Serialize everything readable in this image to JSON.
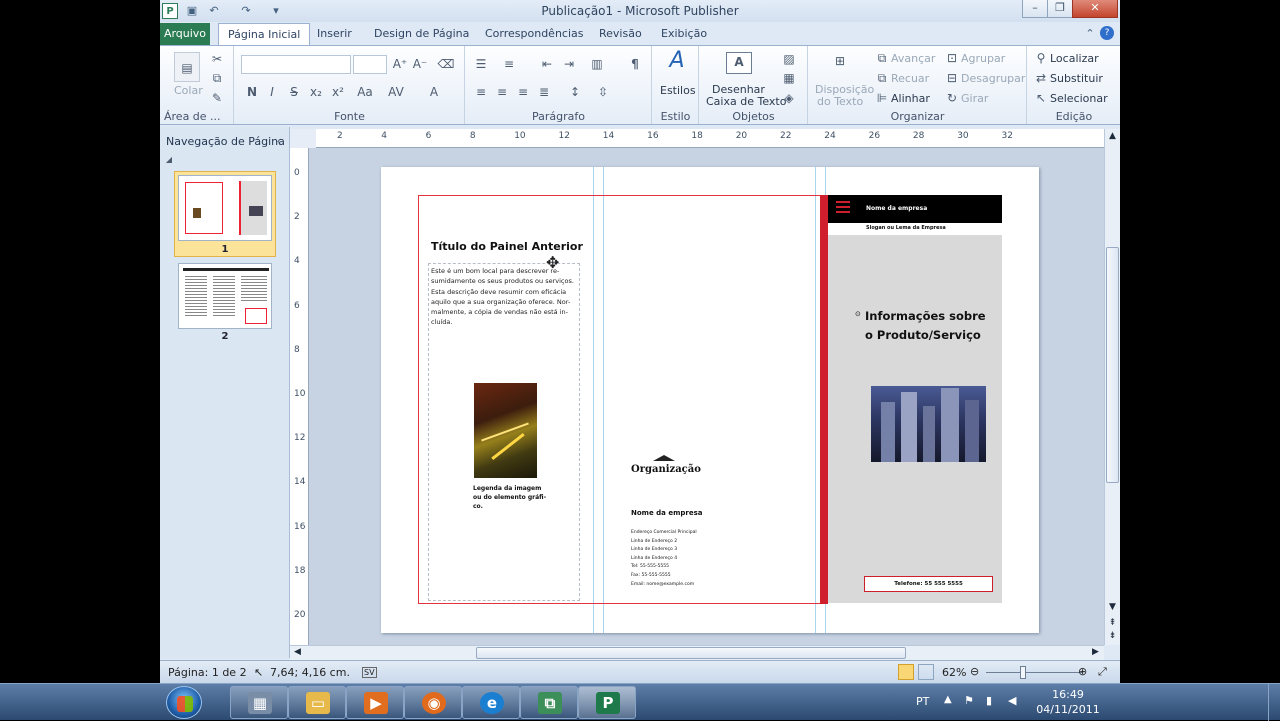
{
  "window": {
    "title": "Publicação1  -  Microsoft Publisher",
    "app_icon": "P",
    "quick_access": [
      "save-icon",
      "undo-icon",
      "redo-icon",
      "customize-icon"
    ]
  },
  "tabs": [
    "Arquivo",
    "Página Inicial",
    "Inserir",
    "Design de Página",
    "Correspondências",
    "Revisão",
    "Exibição"
  ],
  "ribbon": {
    "clipboard": {
      "paste": "Colar",
      "group": "Área de ..."
    },
    "font": {
      "group": "Fonte",
      "font_name": "",
      "font_size": "",
      "bold": "N",
      "italic": "I",
      "underline": "S",
      "sub": "x₂",
      "sup": "x²",
      "case": "Aa"
    },
    "paragraph": {
      "group": "Parágrafo",
      "pilcrow": "¶"
    },
    "styles": {
      "label": "Estilos",
      "group": "Estilo"
    },
    "objects": {
      "draw_textbox_1": "Desenhar",
      "draw_textbox_2": "Caixa de Texto",
      "wrap_1": "Disposição",
      "wrap_2": "do Texto",
      "group": "Objetos"
    },
    "arrange": {
      "forward": "Avançar",
      "backward": "Recuar",
      "align": "Alinhar",
      "group_btn": "Agrupar",
      "ungroup": "Desagrupar",
      "rotate": "Girar",
      "group": "Organizar"
    },
    "editing": {
      "find": "Localizar",
      "replace": "Substituir",
      "select": "Selecionar",
      "group": "Edição"
    }
  },
  "nav": {
    "title": "Navegação de Página",
    "pages": [
      "1",
      "2"
    ]
  },
  "rulers": {
    "h_ticks": [
      "2",
      "4",
      "6",
      "8",
      "10",
      "12",
      "14",
      "16",
      "18",
      "20",
      "22",
      "24",
      "26",
      "28",
      "30",
      "32"
    ],
    "v_ticks": [
      "0",
      "2",
      "4",
      "6",
      "8",
      "10",
      "12",
      "14",
      "16",
      "18",
      "20"
    ]
  },
  "document": {
    "left_title": "Título do Painel Anterior",
    "left_body": [
      "Este é um bom local para descrever re-",
      "sumidamente os seus produtos ou serviços.",
      "Esta descrição deve resumir com eficácia",
      "aquilo que a sua organização oferece. Nor-",
      "malmente, a cópia de vendas não está in-",
      "cluída."
    ],
    "caption": [
      "Legenda da imagem",
      "ou do elemento gráfi-",
      "co."
    ],
    "org_title": "Organização",
    "company": "Nome da empresa",
    "address": [
      "Endereço Comercial Principal",
      "Linha de Endereço 2",
      "Linha de Endereço 3",
      "Linha de Endereço 4",
      "Tel: 55-555-5555",
      "Fax: 55-555-5555",
      "Email: nome@example.com"
    ],
    "cover_company": "Nome da empresa",
    "cover_slogan": "Slogan ou Lema da Empresa",
    "cover_title_1": "Informações sobre",
    "cover_title_2": "o Produto/Serviço",
    "phone": "Telefone: 55 555 5555"
  },
  "status": {
    "page": "Página: 1 de 2",
    "position": "7,64; 4,16 cm.",
    "zoom": "62%"
  },
  "zoom_level_percent": 62,
  "taskbar": {
    "lang": "PT",
    "time": "16:49",
    "date": "04/11/2011",
    "apps": [
      "calculator",
      "explorer",
      "media-player",
      "firefox",
      "internet-explorer",
      "network",
      "publisher"
    ]
  }
}
